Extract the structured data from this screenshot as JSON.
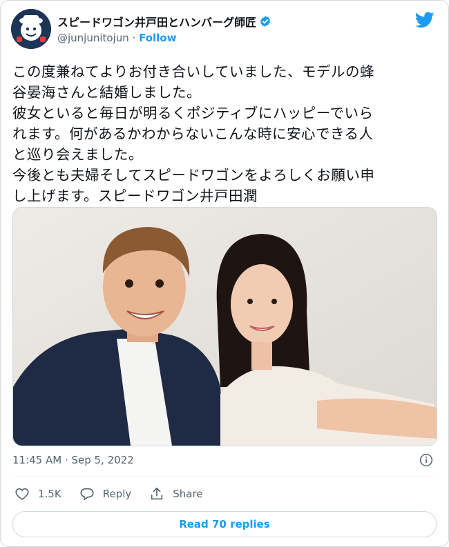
{
  "author": {
    "display_name": "スピードワゴン井戸田とハンバーグ師匠",
    "handle": "@junjunitojun",
    "separator": " · ",
    "follow_label": "Follow"
  },
  "tweet": {
    "lines": [
      "この度兼ねてよりお付き合いしていました、モデルの蜂",
      "谷晏海さんと結婚しました。",
      "彼女といると毎日が明るくポジティブにハッピーでいら",
      "れます。何があるかわからないこんな時に安心できる人",
      "と巡り会えました。",
      "今後とも夫婦そしてスピードワゴンをよろしくお願い申",
      "し上げます。スピードワゴン井戸田潤"
    ]
  },
  "timestamp": "11:45 AM · Sep 5, 2022",
  "actions": {
    "like_count": "1.5K",
    "reply_label": "Reply",
    "share_label": "Share"
  },
  "read_replies_label": "Read 70 replies",
  "colors": {
    "accent": "#1d9bf0",
    "text": "#0f1419",
    "muted": "#536471",
    "border": "#cfd9de"
  }
}
